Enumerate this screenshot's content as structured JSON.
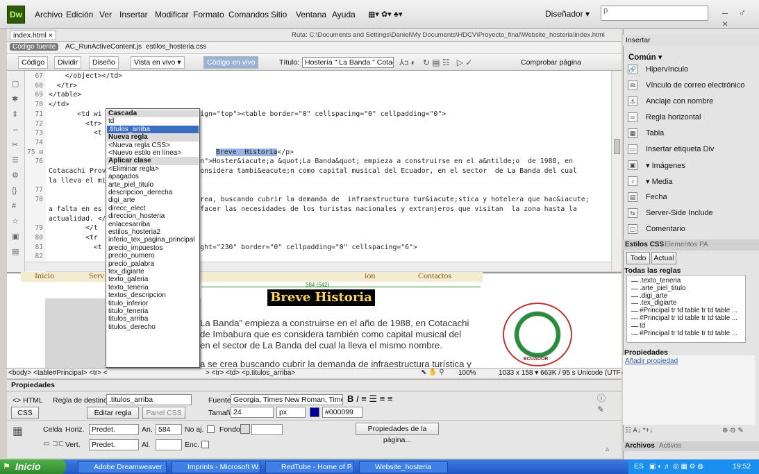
{
  "menu": {
    "logo": "Dw",
    "items": [
      "Archivo",
      "Edición",
      "Ver",
      "Insertar",
      "Modificar",
      "Formato",
      "Comandos",
      "Sitio",
      "Ventana",
      "Ayuda"
    ],
    "workspace": "Diseñador ▾",
    "search_placeholder": "ρ",
    "window_controls": "– ♂ ×"
  },
  "document": {
    "tab": "index.html ×",
    "path": "Ruta: C:\\Documents and Settings\\Daniel\\My Documents\\HDCV\\Proyecto_final\\Website_hosteria\\index.html",
    "related_files": [
      "Código fuente",
      "AC_RunActiveContent.js",
      "estilos_hosteria.css"
    ],
    "view_buttons": [
      "Código",
      "Dividir",
      "Diseño",
      "Vista en vivo ▾",
      "Código en vivo"
    ],
    "title_label": "Título:",
    "title_value": "Hostería \" La Banda \" Cotacac",
    "check_page": "Comprobar página"
  },
  "code": {
    "line_numbers": [
      "67",
      "68",
      "69",
      "70",
      "71",
      "72",
      "73",
      "74",
      "75 ⊟",
      "76",
      "",
      "",
      "77",
      "78",
      "",
      "",
      "79",
      "80",
      "81",
      "82"
    ],
    "lines": [
      "    </object></td>",
      "  </tr>",
      "</table>",
      "</td>",
      "       <td wi                     valign=\"top\"><table border=\"0\" cellspacing=\"0\" cellpadding=\"0\">",
      "         <tr>",
      "           <t",
      "",
      "                                 ba\">",
      "                                 pcion\">Hoster&iacute;a &quot;La Banda&quot; empieza a construirse en el a&ntilde;o  de 1988, en",
      "Cotacachi Prov                   es considera tambi&eacute;n como capital musical del Ecuador, en el sector  de La Banda del cual",
      "la lleva el mi",
      "",
      "                                 se crea, buscando cubrir la demanda de  infraestructura tur&iacute;stica y hotelera que hac&iacute;",
      "a falta en es                    atisfacer las necesidades de los turistas nacionales y extranjeros que visitan  la zona hasta la",
      "actualidad. </",
      "         </t",
      "         <tr",
      "           <t                     height=\"230\" border=\"0\" cellpadding=\"0\" cellspacing=\"6\">",
      ""
    ],
    "selected_text": "Breve  Historia",
    "selected_tail": "</p>"
  },
  "design": {
    "nav": [
      "Inicio",
      "Serv",
      "ion",
      "Contactos"
    ],
    "width_indicator": "584 (542)",
    "heading": "Breve Historia",
    "paragraph_lines": [
      "La Banda\" empieza a construirse en el año de 1988, en Cotacachi",
      "de Imbabura que es considera también como capital musical del",
      "en el sector de La Banda del cual la lleva el mismo nombre.",
      "a se crea  buscando cubrir la demanda de infraestructura turística y"
    ],
    "seal_text": "ECUADOR"
  },
  "statusbar": {
    "tag_path": "<body> <table#Principal> <tr> <",
    "tag_path_tail": "> <tr> <td> <p.titulos_arriba>",
    "zoom": "100%",
    "info": "1033 x 158 ▾  663K / 95 s  Unicode (UTF-8)"
  },
  "popup": {
    "section_cascada": "Cascada",
    "cascada_items": [
      "td",
      ".titulos_arriba"
    ],
    "section_nueva": "Nueva regla",
    "nueva_items": [
      "<Nueva regla CSS>",
      "<Nuevo estilo en línea>"
    ],
    "section_aplicar": "Aplicar clase",
    "class_items": [
      "<Eliminar regla>",
      "apagados",
      "arte_piel_titulo",
      "descripcion_derecha",
      "digi_arte",
      "direcc_elect",
      "direccion_hosteria",
      "enlacesarriba",
      "estilos_hosteria2",
      "inferio_tex_pagina_principal",
      "precio_impuestos",
      "precio_numero",
      "precio_palabra",
      "tex_digiarte",
      "texto_galeria",
      "texto_teneria",
      "textos_descripcion",
      "titulo_inferior",
      "titulo_teneria",
      "titulos_arriba",
      "titulos_derecho"
    ]
  },
  "properties": {
    "title": "Propiedades",
    "html_tab": "<> HTML",
    "css_tab": "CSS",
    "target_rule_label": "Regla de destino",
    "target_rule_value": ".titulos_arriba",
    "edit_rule": "Editar regla",
    "css_panel": "Panel CSS",
    "font_label": "Fuente",
    "font_value": "Georgia, Times New Roman, Time",
    "size_label": "Tamaño",
    "size_value": "24",
    "size_unit": "px",
    "color_value": "#000099",
    "color_hex": "#000099",
    "cell_label": "Celda",
    "horiz_label": "Horiz.",
    "horiz_value": "Predet.",
    "width_label": "An.",
    "width_value": "584",
    "nowrap_label": "No aj.",
    "bg_label": "Fondo",
    "vert_label": "Vert.",
    "vert_value": "Predet.",
    "height_label": "Al.",
    "header_label": "Enc.",
    "page_props": "Propiedades de la página..."
  },
  "right_panel": {
    "insert_title": "Insertar",
    "category": "Común ▾",
    "insert_items": [
      {
        "icon": "🔗",
        "label": "Hipervínculo"
      },
      {
        "icon": "✉",
        "label": "Vínculo de correo electrónico"
      },
      {
        "icon": "⚓",
        "label": "Anclaje con nombre"
      },
      {
        "icon": "═",
        "label": "Regla horizontal"
      },
      {
        "icon": "▦",
        "label": "Tabla"
      },
      {
        "icon": "▭",
        "label": "Insertar etiqueta Div"
      },
      {
        "icon": "▣",
        "label": "▾ Imágenes"
      },
      {
        "icon": "♪",
        "label": "▾ Media"
      },
      {
        "icon": "▤",
        "label": "Fecha"
      },
      {
        "icon": "⇆",
        "label": "Server-Side Include"
      },
      {
        "icon": "▢",
        "label": "Comentario"
      }
    ],
    "css_tabs": [
      "Estilos CSS",
      "Elementos PA"
    ],
    "mode_buttons": [
      "Todo",
      "Actual"
    ],
    "all_rules": "Todas las reglas",
    "rules": [
      ".texto_teneria",
      ".arte_piel_titulo",
      ".digi_arte",
      ".tex_digiarte",
      "#Principal tr td table tr td table ...",
      "#Principal tr td table tr td table ...",
      "td",
      "#Principal tr td table tr td table ..."
    ],
    "props_title": "Propiedades",
    "add_property": "Añadir propiedad",
    "files_tabs": [
      "Archivos",
      "Activos"
    ]
  },
  "taskbar": {
    "start": "Inicio",
    "tasks": [
      "Adobe Dreamweaver ...",
      "Imprints - Microsoft W...",
      "RedTube - Home of P...",
      "Website_hosteria"
    ],
    "lang": "ES",
    "time": "19:52"
  },
  "colors": {
    "dw_green": "#2d5a05",
    "heading_gold": "#f7d35c",
    "selection_blue": "#3a6ec0",
    "taskbar_blue": "#2257c4"
  }
}
